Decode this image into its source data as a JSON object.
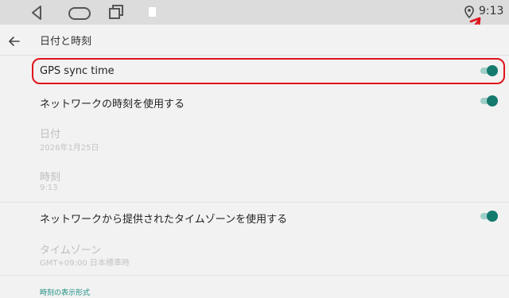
{
  "status_bar": {
    "time": "9:13"
  },
  "app_bar": {
    "title": "日付と時刻"
  },
  "settings": {
    "gps_sync": {
      "label": "GPS sync time",
      "enabled": true
    },
    "network_time": {
      "label": "ネットワークの時刻を使用する",
      "enabled": true
    },
    "date": {
      "label": "日付",
      "value": "2026年1月25日"
    },
    "time": {
      "label": "時刻",
      "value": "9:13"
    },
    "network_timezone": {
      "label": "ネットワークから提供されたタイムゾーンを使用する",
      "enabled": true
    },
    "timezone": {
      "label": "タイムゾーン",
      "value": "GMT+09:00 日本標準時"
    },
    "format_section": {
      "label": "時刻の表示形式"
    }
  },
  "colors": {
    "accent": "#157a6e",
    "annotation": "#e0141b"
  }
}
